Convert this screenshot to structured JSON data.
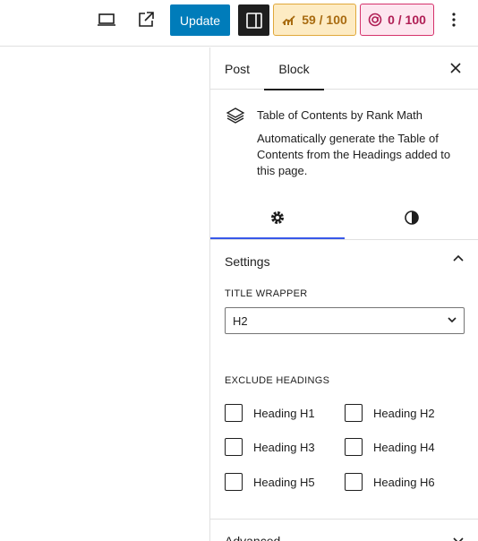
{
  "toolbar": {
    "update_label": "Update",
    "seo_score": "59 / 100",
    "content_score": "0 / 100",
    "icons": [
      "desktop-preview-icon",
      "external-link-icon",
      "sidebar-toggle-icon",
      "more-options-icon"
    ]
  },
  "colors": {
    "update_bg": "#007cba",
    "seo_bg": "#fdebc3",
    "seo_text": "#a86b10",
    "content_bg": "#fde6ef",
    "content_text": "#b01f55",
    "active_tab_underline": "#3858e9"
  },
  "sidebar": {
    "tabs": [
      {
        "label": "Post"
      },
      {
        "label": "Block"
      }
    ],
    "block": {
      "title": "Table of Contents by Rank Math",
      "description": "Automatically generate the Table of Contents from the Headings added to this page."
    },
    "settings_panel": {
      "title": "Settings",
      "title_wrapper_label": "TITLE WRAPPER",
      "title_wrapper_value": "H2",
      "exclude_headings_label": "EXCLUDE HEADINGS",
      "headings": [
        "Heading H1",
        "Heading H2",
        "Heading H3",
        "Heading H4",
        "Heading H5",
        "Heading H6"
      ]
    },
    "advanced_panel": {
      "title": "Advanced"
    }
  }
}
